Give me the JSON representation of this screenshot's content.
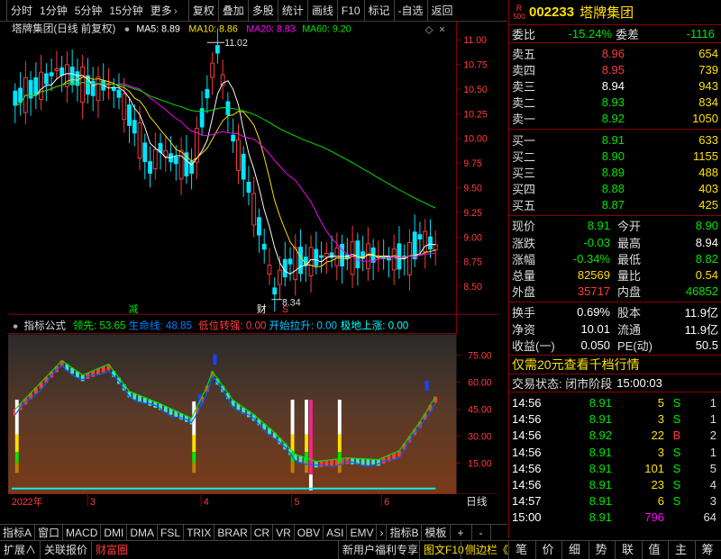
{
  "toolbar": {
    "period_tabs": [
      "分时",
      "1分钟",
      "5分钟",
      "15分钟",
      "更多"
    ],
    "more_arrow": "›",
    "actions": [
      "复权",
      "叠加",
      "多股",
      "统计",
      "画线",
      "F10",
      "标记",
      "-自选",
      "返回"
    ]
  },
  "main_chart": {
    "title": "塔牌集团(日线 前复权)",
    "indicators": [
      {
        "label": "MA5: 8.89",
        "color": "#ffffff"
      },
      {
        "label": "MA10: 8.86",
        "color": "#ffe000"
      },
      {
        "label": "MA20: 8.83",
        "color": "#ff00ff"
      },
      {
        "label": "MA60: 9.20",
        "color": "#00e600"
      }
    ],
    "price_ticks": [
      "11.00",
      "10.75",
      "10.50",
      "10.25",
      "10.00",
      "9.75",
      "9.50",
      "9.25",
      "9.00",
      "8.75",
      "8.50"
    ],
    "high_label": "11.02",
    "low_label": "8.34",
    "mark_jian": "减",
    "mark_cai": "财",
    "mark_s": "S"
  },
  "sub_chart": {
    "title": "指标公式",
    "readouts": [
      {
        "label": "领先: 53.65",
        "color": "#00e600"
      },
      {
        "label": "生命线: 48.85",
        "color": "#0080ff"
      },
      {
        "label": "低位转强: 0.00",
        "color": "#ff3c3c"
      },
      {
        "label": "开始拉升: 0.00",
        "color": "#00c8ff"
      },
      {
        "label": "极地上涨: 0.00",
        "color": "#00ffff"
      }
    ],
    "ticks": [
      "75.00",
      "60.00",
      "45.00",
      "30.00",
      "15.00"
    ]
  },
  "time_axis": {
    "labels": [
      "2022年",
      "3",
      "4",
      "5",
      "6"
    ],
    "period": "日线"
  },
  "bottom_tabs": [
    "指标A",
    "窗口",
    "MACD",
    "DMI",
    "DMA",
    "FSL",
    "TRIX",
    "BRAR",
    "CR",
    "VR",
    "OBV",
    "ASI",
    "EMV"
  ],
  "bottom_tabs_right": [
    "指标B",
    "模板",
    "+",
    "-"
  ],
  "quote": {
    "stock_code": "002233",
    "stock_name": "塔牌集团",
    "badge_top": "R",
    "badge_bottom": "500",
    "weibi_label": "委比",
    "weibi_value": "-15.24%",
    "weicha_label": "委差",
    "weicha_value": "-1116",
    "asks": [
      {
        "label": "卖五",
        "price": "8.96",
        "vol": "654"
      },
      {
        "label": "卖四",
        "price": "8.95",
        "vol": "739"
      },
      {
        "label": "卖三",
        "price": "8.94",
        "vol": "943"
      },
      {
        "label": "卖二",
        "price": "8.93",
        "vol": "834"
      },
      {
        "label": "卖一",
        "price": "8.92",
        "vol": "1050"
      }
    ],
    "bids": [
      {
        "label": "买一",
        "price": "8.91",
        "vol": "633"
      },
      {
        "label": "买二",
        "price": "8.90",
        "vol": "1155"
      },
      {
        "label": "买三",
        "price": "8.89",
        "vol": "488"
      },
      {
        "label": "买四",
        "price": "8.88",
        "vol": "403"
      },
      {
        "label": "买五",
        "price": "8.87",
        "vol": "425"
      }
    ],
    "stats": [
      {
        "l1": "现价",
        "v1": "8.91",
        "l2": "今开",
        "v2": "8.90"
      },
      {
        "l1": "涨跌",
        "v1": "-0.03",
        "l2": "最高",
        "v2": "8.94"
      },
      {
        "l1": "涨幅",
        "v1": "-0.34%",
        "l2": "最低",
        "v2": "8.82"
      },
      {
        "l1": "总量",
        "v1": "82569",
        "l2": "量比",
        "v2": "0.54"
      },
      {
        "l1": "外盘",
        "v1": "35717",
        "l2": "内盘",
        "v2": "46852"
      }
    ],
    "stats2": [
      {
        "l1": "换手",
        "v1": "0.69%",
        "l2": "股本",
        "v2": "11.9亿"
      },
      {
        "l1": "净资",
        "v1": "10.01",
        "l2": "流通",
        "v2": "11.9亿"
      },
      {
        "l1": "收益(一)",
        "v1": "0.050",
        "l2": "PE(动)",
        "v2": "50.5"
      }
    ],
    "promo": "仅需20元查看千档行情",
    "status_label": "交易状态: 闭市阶段",
    "status_time": "15:00:03",
    "ticks": [
      {
        "t": "14:56",
        "p": "8.91",
        "v": "5",
        "bs": "S",
        "n": "1"
      },
      {
        "t": "14:56",
        "p": "8.91",
        "v": "3",
        "bs": "S",
        "n": "1"
      },
      {
        "t": "14:56",
        "p": "8.92",
        "v": "22",
        "bs": "B",
        "n": "2"
      },
      {
        "t": "14:56",
        "p": "8.91",
        "v": "3",
        "bs": "S",
        "n": "1"
      },
      {
        "t": "14:56",
        "p": "8.91",
        "v": "101",
        "bs": "S",
        "n": "5"
      },
      {
        "t": "14:56",
        "p": "8.91",
        "v": "23",
        "bs": "S",
        "n": "4"
      },
      {
        "t": "14:57",
        "p": "8.91",
        "v": "6",
        "bs": "S",
        "n": "3"
      },
      {
        "t": "15:00",
        "p": "8.91",
        "v": "796",
        "bs": "",
        "n": "64"
      }
    ]
  },
  "footer": {
    "left": [
      "扩展∧",
      "关联报价",
      "财富圈"
    ],
    "mid": [
      "新用户福利专享",
      "图文F10",
      "侧边栏《"
    ],
    "symbols": [
      "笔",
      "价",
      "细",
      "势",
      "联",
      "值",
      "主",
      "筹"
    ]
  }
}
